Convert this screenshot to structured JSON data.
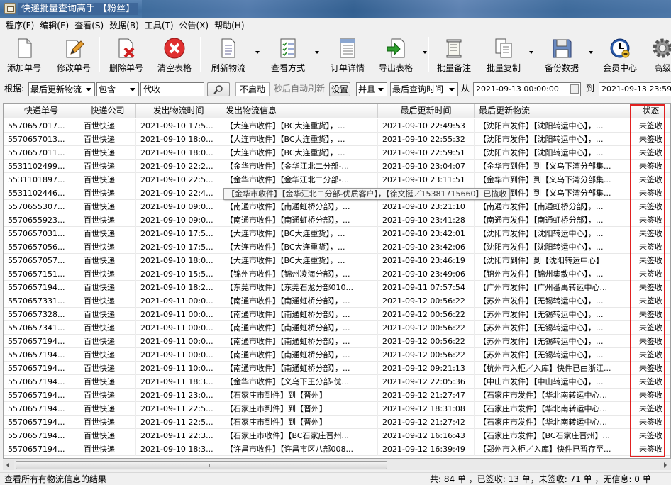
{
  "window": {
    "title": "快递批量查询高手 【粉丝】"
  },
  "menu": [
    "程序(F)",
    "编辑(E)",
    "查看(S)",
    "数据(B)",
    "工具(T)",
    "公告(X)",
    "帮助(H)"
  ],
  "toolbar": [
    {
      "label": "添加单号",
      "icon": "add-doc-icon"
    },
    {
      "label": "修改单号",
      "icon": "edit-pencil-icon"
    },
    {
      "label": "删除单号",
      "icon": "delete-doc-icon"
    },
    {
      "label": "清空表格",
      "icon": "clear-red-x-icon"
    },
    {
      "label": "刷新物流",
      "icon": "refresh-doc-icon"
    },
    {
      "label": "查看方式",
      "icon": "checklist-icon"
    },
    {
      "label": "订单详情",
      "icon": "order-detail-icon"
    },
    {
      "label": "导出表格",
      "icon": "export-arrow-icon"
    },
    {
      "label": "批量备注",
      "icon": "scroll-note-icon"
    },
    {
      "label": "批量复制",
      "icon": "copy-doc-icon"
    },
    {
      "label": "备份数据",
      "icon": "floppy-disk-icon"
    },
    {
      "label": "会员中心",
      "icon": "clock-icon"
    },
    {
      "label": "高级",
      "icon": "gear-icon"
    }
  ],
  "filter": {
    "basis_label": "根据:",
    "basis_value": "最后更新物流",
    "match_value": "包含",
    "keyword": "代收",
    "autostart_label": "不启动",
    "auto_refresh_label": "秒后自动刷新",
    "set_label": "设置",
    "logic_value": "并且",
    "time_field_value": "最后查询时间",
    "from_label": "从",
    "from_value": "2021-09-13 00:00:00",
    "to_label": "到",
    "to_value": "2021-09-13 23:59"
  },
  "table": {
    "headers": [
      "快递单号",
      "快递公司",
      "发出物流时间",
      "发出物流信息",
      "最后更新时间",
      "最后更新物流",
      "状态"
    ],
    "rows": [
      [
        "5570657017...",
        "百世快递",
        "2021-09-10 17:5...",
        "【大连市收件】【BC大连重货】，...",
        "2021-09-10 22:49:53",
        "【沈阳市发件】【沈阳转运中心】，...",
        "未签收"
      ],
      [
        "5570657013...",
        "百世快递",
        "2021-09-10 18:0...",
        "【大连市收件】【BC大连重货】，...",
        "2021-09-10 22:55:32",
        "【沈阳市发件】【沈阳转运中心】，...",
        "未签收"
      ],
      [
        "5570657011...",
        "百世快递",
        "2021-09-10 18:0...",
        "【大连市收件】【BC大连重货】，...",
        "2021-09-10 22:59:51",
        "【沈阳市发件】【沈阳转运中心】，...",
        "未签收"
      ],
      [
        "5531102499...",
        "百世快递",
        "2021-09-10 22:2...",
        "【金华市收件】【金华江北二分部-...",
        "2021-09-10 23:04:07",
        "【金华市到件】到【义乌下湾分部集...",
        "未签收"
      ],
      [
        "5531101897...",
        "百世快递",
        "2021-09-10 22:5...",
        "【金华市收件】【金华江北二分部-...",
        "2021-09-10 23:11:51",
        "【金华市到件】到【义乌下湾分部集...",
        "未签收"
      ],
      [
        "5531102446...",
        "百世快递",
        "2021-09-10 22:4...",
        "【金华市收件】【金华江北二分部-...",
        "2021-09-10 23:16:23",
        "【金华市到件】到【义乌下湾分部集...",
        "未签收"
      ],
      [
        "5570655307...",
        "百世快递",
        "2021-09-10 09:0...",
        "【南通市收件】【南通虹桥分部】，...",
        "2021-09-10 23:21:10",
        "【南通市发件】【南通虹桥分部】，...",
        "未签收"
      ],
      [
        "5570655923...",
        "百世快递",
        "2021-09-10 09:0...",
        "【南通市收件】【南通虹桥分部】，...",
        "2021-09-10 23:41:28",
        "【南通市发件】【南通虹桥分部】，...",
        "未签收"
      ],
      [
        "5570657031...",
        "百世快递",
        "2021-09-10 17:5...",
        "【大连市收件】【BC大连重货】，...",
        "2021-09-10 23:42:01",
        "【沈阳市发件】【沈阳转运中心】，...",
        "未签收"
      ],
      [
        "5570657056...",
        "百世快递",
        "2021-09-10 17:5...",
        "【大连市收件】【BC大连重货】，...",
        "2021-09-10 23:42:06",
        "【沈阳市发件】【沈阳转运中心】，...",
        "未签收"
      ],
      [
        "5570657057...",
        "百世快递",
        "2021-09-10 18:0...",
        "【大连市收件】【BC大连重货】，...",
        "2021-09-10 23:46:19",
        "【沈阳市到件】到【沈阳转运中心】",
        "未签收"
      ],
      [
        "5570657151...",
        "百世快递",
        "2021-09-10 15:5...",
        "【锦州市收件】【锦州凌海分部】，...",
        "2021-09-10 23:49:06",
        "【锦州市发件】【锦州集散中心】，...",
        "未签收"
      ],
      [
        "5570657194...",
        "百世快递",
        "2021-09-10 18:2...",
        "【东莞市收件】【东莞石龙分部010...",
        "2021-09-11 07:57:54",
        "【广州市发件】【广州番禺转运中心...",
        "未签收"
      ],
      [
        "5570657331...",
        "百世快递",
        "2021-09-11 00:0...",
        "【南通市收件】【南通虹桥分部】，...",
        "2021-09-12 00:56:22",
        "【苏州市发件】【无锡转运中心】，...",
        "未签收"
      ],
      [
        "5570657328...",
        "百世快递",
        "2021-09-11 00:0...",
        "【南通市收件】【南通虹桥分部】，...",
        "2021-09-12 00:56:22",
        "【苏州市发件】【无锡转运中心】，...",
        "未签收"
      ],
      [
        "5570657341...",
        "百世快递",
        "2021-09-11 00:0...",
        "【南通市收件】【南通虹桥分部】，...",
        "2021-09-12 00:56:22",
        "【苏州市发件】【无锡转运中心】，...",
        "未签收"
      ],
      [
        "5570657194...",
        "百世快递",
        "2021-09-11 00:0...",
        "【南通市收件】【南通虹桥分部】，...",
        "2021-09-12 00:56:22",
        "【苏州市发件】【无锡转运中心】，...",
        "未签收"
      ],
      [
        "5570657194...",
        "百世快递",
        "2021-09-11 00:0...",
        "【南通市收件】【南通虹桥分部】，...",
        "2021-09-12 00:56:22",
        "【苏州市发件】【无锡转运中心】，...",
        "未签收"
      ],
      [
        "5570657194...",
        "百世快递",
        "2021-09-11 10:0...",
        "【南通市收件】【南通虹桥分部】，...",
        "2021-09-12 09:21:13",
        "【杭州市入柜／入库】快件已由浙江...",
        "未签收"
      ],
      [
        "5570657194...",
        "百世快递",
        "2021-09-11 18:3...",
        "【金华市收件】【义乌下王分部-优...",
        "2021-09-12 22:05:36",
        "【中山市发件】【中山转运中心】，...",
        "未签收"
      ],
      [
        "5570657194...",
        "百世快递",
        "2021-09-11 23:0...",
        "【石家庄市到件】到【晋州】",
        "2021-09-12 21:27:47",
        "【石家庄市发件】【华北南转运中心...",
        "未签收"
      ],
      [
        "5570657194...",
        "百世快递",
        "2021-09-11 22:5...",
        "【石家庄市到件】到【晋州】",
        "2021-09-12 18:31:08",
        "【石家庄市发件】【华北南转运中心...",
        "未签收"
      ],
      [
        "5570657194...",
        "百世快递",
        "2021-09-11 22:5...",
        "【石家庄市到件】到【晋州】",
        "2021-09-12 21:27:42",
        "【石家庄市发件】【华北南转运中心...",
        "未签收"
      ],
      [
        "5570657194...",
        "百世快递",
        "2021-09-11 22:3...",
        "【石家庄市收件】【BC石家庄晋州...",
        "2021-09-12 16:16:43",
        "【石家庄市发件】【BC石家庄晋州】...",
        "未签收"
      ],
      [
        "5570657194...",
        "百世快递",
        "2021-09-10 18:3...",
        "【许昌市收件】【许昌市区八部008...",
        "2021-09-12 16:39:49",
        "【郑州市入柜／入库】快件已暂存至...",
        "未签收"
      ]
    ],
    "tooltip": "【金华市收件】【金华江北二分部-优质客户】，【徐文挺／15381715660】已揽收"
  },
  "status": {
    "left": "查看所有有物流信息的结果",
    "right": "共: 84 单 ，已签收:  13 单，未签收:  71 单 ，无信息: 0 单"
  }
}
